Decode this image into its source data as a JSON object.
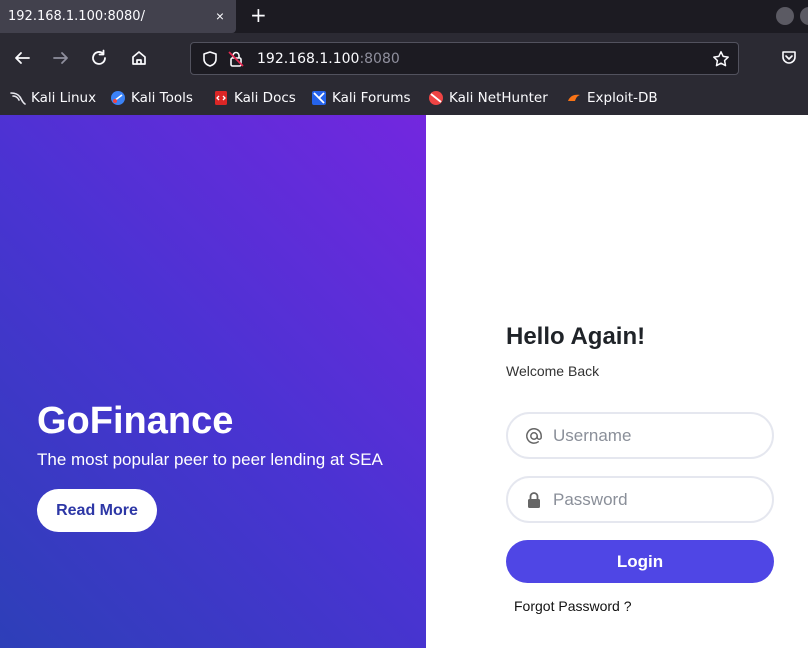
{
  "browser": {
    "tab_title": "192.168.1.100:8080/",
    "tab_close": "×",
    "new_tab": "+",
    "url_host": "192.168.1.100",
    "url_port": ":8080",
    "bookmarks": [
      {
        "label": "Kali Linux",
        "icon": "kali-dragon-icon"
      },
      {
        "label": "Kali Tools",
        "icon": "kali-tools-icon"
      },
      {
        "label": "Kali Docs",
        "icon": "kali-docs-icon"
      },
      {
        "label": "Kali Forums",
        "icon": "kali-forums-icon"
      },
      {
        "label": "Kali NetHunter",
        "icon": "kali-nethunter-icon"
      },
      {
        "label": "Exploit-DB",
        "icon": "exploit-db-icon"
      }
    ]
  },
  "hero": {
    "brand": "GoFinance",
    "tagline": "The most popular peer to peer lending at SEA",
    "read_more": "Read More",
    "gradient": [
      "#2d3fb8",
      "#4a33d2",
      "#7327df"
    ]
  },
  "login": {
    "title": "Hello Again!",
    "subtitle": "Welcome Back",
    "username_placeholder": "Username",
    "password_placeholder": "Password",
    "submit": "Login",
    "forgot": "Forgot Password ?",
    "accent": "#4f46e5"
  }
}
